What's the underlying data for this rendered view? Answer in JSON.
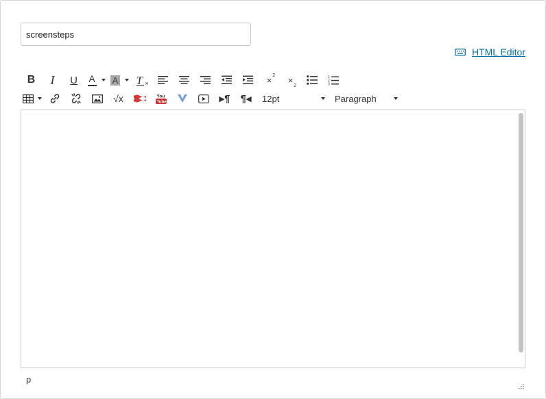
{
  "title_field": {
    "value": "screensteps"
  },
  "html_editor": {
    "label": "HTML Editor",
    "icon": "keyboard-icon"
  },
  "toolbar": {
    "bold": "B",
    "italic": "I",
    "underline": "U",
    "text_color": "A",
    "background_color": "A",
    "clear_formatting": "T",
    "font_size": "12pt",
    "block_format": "Paragraph"
  },
  "statusbar": {
    "path": "p"
  },
  "colors": {
    "link": "#0770a3",
    "border": "#c9cdd2",
    "scrollbar": "#c3c3c3"
  }
}
